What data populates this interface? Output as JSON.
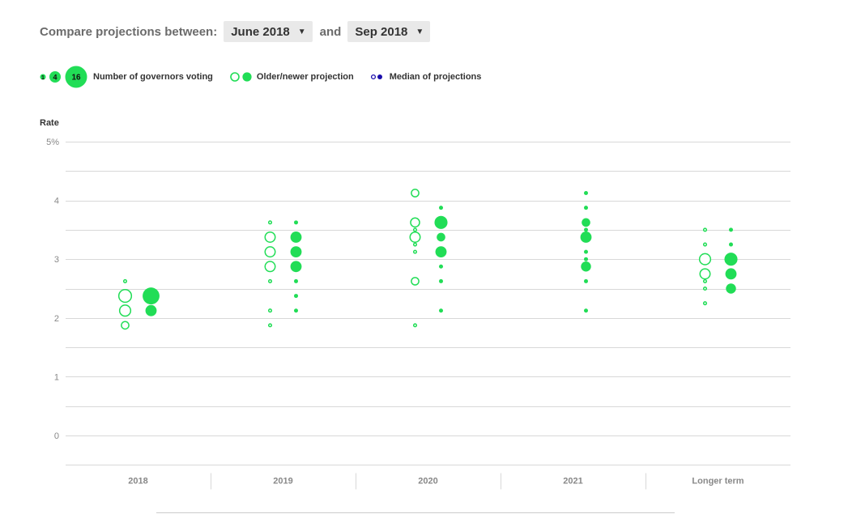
{
  "controls": {
    "compare_label": "Compare projections between:",
    "older_select": "June 2018",
    "and_label": "and",
    "newer_select": "Sep 2018",
    "caret": "▼"
  },
  "legend": {
    "size_small": "1",
    "size_mid": "4",
    "size_large": "16",
    "size_label": "Number of governors voting",
    "older_newer_label": "Older/newer projection",
    "median_label": "Median of projections"
  },
  "colors": {
    "projection": "#21dd56",
    "median": "#1a0dab",
    "grid": "#d8d8d8"
  },
  "chart_data": {
    "type": "scatter",
    "ylabel": "Rate",
    "ylim": [
      0,
      5
    ],
    "yticks": [
      {
        "value": 0,
        "label": "0"
      },
      {
        "value": 1,
        "label": "1"
      },
      {
        "value": 2,
        "label": "2"
      },
      {
        "value": 3,
        "label": "3"
      },
      {
        "value": 4,
        "label": "4"
      },
      {
        "value": 5,
        "label": "5%"
      }
    ],
    "grid_minor": [
      0.5,
      1.5,
      2.5,
      3.5,
      4.5
    ],
    "categories": [
      "2018",
      "2019",
      "2020",
      "2021",
      "Longer term"
    ],
    "series": [
      {
        "name": "Older projection",
        "style": "hollow",
        "points": [
          [
            {
              "rate": 2.625,
              "count": 1
            },
            {
              "rate": 2.375,
              "count": 7
            },
            {
              "rate": 2.125,
              "count": 5
            },
            {
              "rate": 1.875,
              "count": 2
            }
          ],
          [
            {
              "rate": 3.625,
              "count": 1
            },
            {
              "rate": 3.375,
              "count": 4
            },
            {
              "rate": 3.125,
              "count": 4
            },
            {
              "rate": 2.875,
              "count": 4
            },
            {
              "rate": 2.625,
              "count": 1
            },
            {
              "rate": 2.125,
              "count": 1
            },
            {
              "rate": 1.875,
              "count": 1
            }
          ],
          [
            {
              "rate": 4.125,
              "count": 2
            },
            {
              "rate": 3.625,
              "count": 3
            },
            {
              "rate": 3.5,
              "count": 1
            },
            {
              "rate": 3.375,
              "count": 4
            },
            {
              "rate": 3.25,
              "count": 1
            },
            {
              "rate": 3.125,
              "count": 1
            },
            {
              "rate": 2.625,
              "count": 2
            },
            {
              "rate": 1.875,
              "count": 1
            }
          ],
          [],
          [
            {
              "rate": 3.5,
              "count": 1
            },
            {
              "rate": 3.25,
              "count": 1
            },
            {
              "rate": 3.0,
              "count": 5
            },
            {
              "rate": 2.75,
              "count": 4
            },
            {
              "rate": 2.625,
              "count": 1
            },
            {
              "rate": 2.5,
              "count": 1
            },
            {
              "rate": 2.25,
              "count": 1
            }
          ]
        ]
      },
      {
        "name": "Newer projection",
        "style": "filled",
        "points": [
          [
            {
              "rate": 2.375,
              "count": 12
            },
            {
              "rate": 2.125,
              "count": 4
            }
          ],
          [
            {
              "rate": 3.625,
              "count": 1
            },
            {
              "rate": 3.375,
              "count": 4
            },
            {
              "rate": 3.125,
              "count": 4
            },
            {
              "rate": 2.875,
              "count": 4
            },
            {
              "rate": 2.625,
              "count": 1
            },
            {
              "rate": 2.375,
              "count": 1
            },
            {
              "rate": 2.125,
              "count": 1
            }
          ],
          [
            {
              "rate": 3.875,
              "count": 1
            },
            {
              "rate": 3.625,
              "count": 6
            },
            {
              "rate": 3.375,
              "count": 2
            },
            {
              "rate": 3.125,
              "count": 4
            },
            {
              "rate": 2.875,
              "count": 1
            },
            {
              "rate": 2.625,
              "count": 1
            },
            {
              "rate": 2.125,
              "count": 1
            }
          ],
          [
            {
              "rate": 4.125,
              "count": 1
            },
            {
              "rate": 3.875,
              "count": 1
            },
            {
              "rate": 3.625,
              "count": 2
            },
            {
              "rate": 3.5,
              "count": 1
            },
            {
              "rate": 3.375,
              "count": 4
            },
            {
              "rate": 3.125,
              "count": 1
            },
            {
              "rate": 3.0,
              "count": 1
            },
            {
              "rate": 2.875,
              "count": 3
            },
            {
              "rate": 2.625,
              "count": 1
            },
            {
              "rate": 2.125,
              "count": 1
            }
          ],
          [
            {
              "rate": 3.5,
              "count": 1
            },
            {
              "rate": 3.25,
              "count": 1
            },
            {
              "rate": 3.0,
              "count": 6
            },
            {
              "rate": 2.75,
              "count": 4
            },
            {
              "rate": 2.5,
              "count": 3
            }
          ]
        ]
      }
    ]
  }
}
